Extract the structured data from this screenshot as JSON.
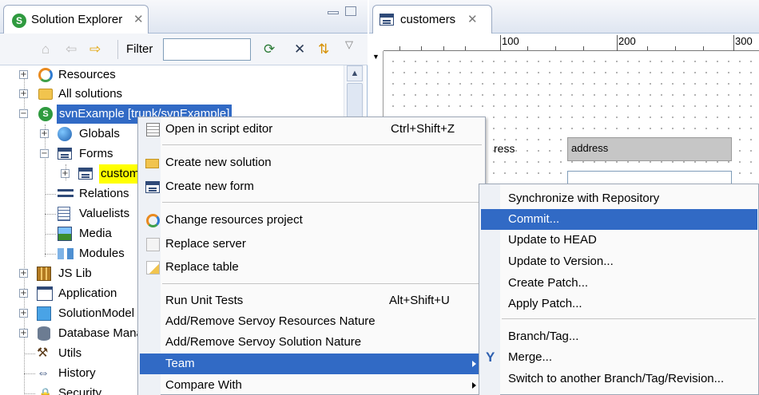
{
  "explorer": {
    "tab_title": "Solution Explorer",
    "filter_label": "Filter",
    "filter_value": "",
    "tree": [
      {
        "label": "Resources"
      },
      {
        "label": "All solutions"
      },
      {
        "label": "svnExample [trunk/svnExample]"
      },
      {
        "label": "Globals"
      },
      {
        "label": "Forms"
      },
      {
        "label": "customers"
      },
      {
        "label": "Relations"
      },
      {
        "label": "Valuelists"
      },
      {
        "label": "Media"
      },
      {
        "label": "Modules"
      },
      {
        "label": "JS Lib"
      },
      {
        "label": "Application"
      },
      {
        "label": "SolutionModel"
      },
      {
        "label": "Database Manager"
      },
      {
        "label": "Utils"
      },
      {
        "label": "History"
      },
      {
        "label": "Security"
      }
    ]
  },
  "editor": {
    "tab_title": "customers",
    "ruler": [
      "100",
      "200",
      "300"
    ],
    "field_label_partial": "ress",
    "field_value": "address"
  },
  "context_menu": {
    "items": [
      {
        "label": "Open in script editor",
        "shortcut": "Ctrl+Shift+Z",
        "icon": "script-editor-icon"
      },
      {
        "label": "Create new solution",
        "icon": "folder-open-icon"
      },
      {
        "label": "Create new form",
        "icon": "form-icon"
      },
      {
        "label": "Change resources project",
        "icon": "resources-icon"
      },
      {
        "label": "Replace server",
        "icon": "server-icon"
      },
      {
        "label": "Replace table",
        "icon": "table-icon"
      },
      {
        "label": "Run Unit Tests",
        "shortcut": "Alt+Shift+U"
      },
      {
        "label": "Add/Remove Servoy Resources Nature"
      },
      {
        "label": "Add/Remove Servoy Solution Nature"
      },
      {
        "label": "Team",
        "highlighted": true,
        "has_submenu": true
      },
      {
        "label": "Compare With",
        "has_submenu": true
      }
    ]
  },
  "team_submenu": {
    "items": [
      {
        "label": "Synchronize with Repository"
      },
      {
        "label": "Commit...",
        "highlighted": true
      },
      {
        "label": "Update to HEAD"
      },
      {
        "label": "Update to Version..."
      },
      {
        "label": "Create Patch..."
      },
      {
        "label": "Apply Patch..."
      },
      {
        "label": "Branch/Tag..."
      },
      {
        "label": "Merge...",
        "icon": "merge-icon"
      },
      {
        "label": "Switch to another Branch/Tag/Revision..."
      }
    ]
  },
  "colors": {
    "selection": "#316ac5",
    "solution_highlight": "#316ac5",
    "form_highlight": "#ffff00"
  }
}
